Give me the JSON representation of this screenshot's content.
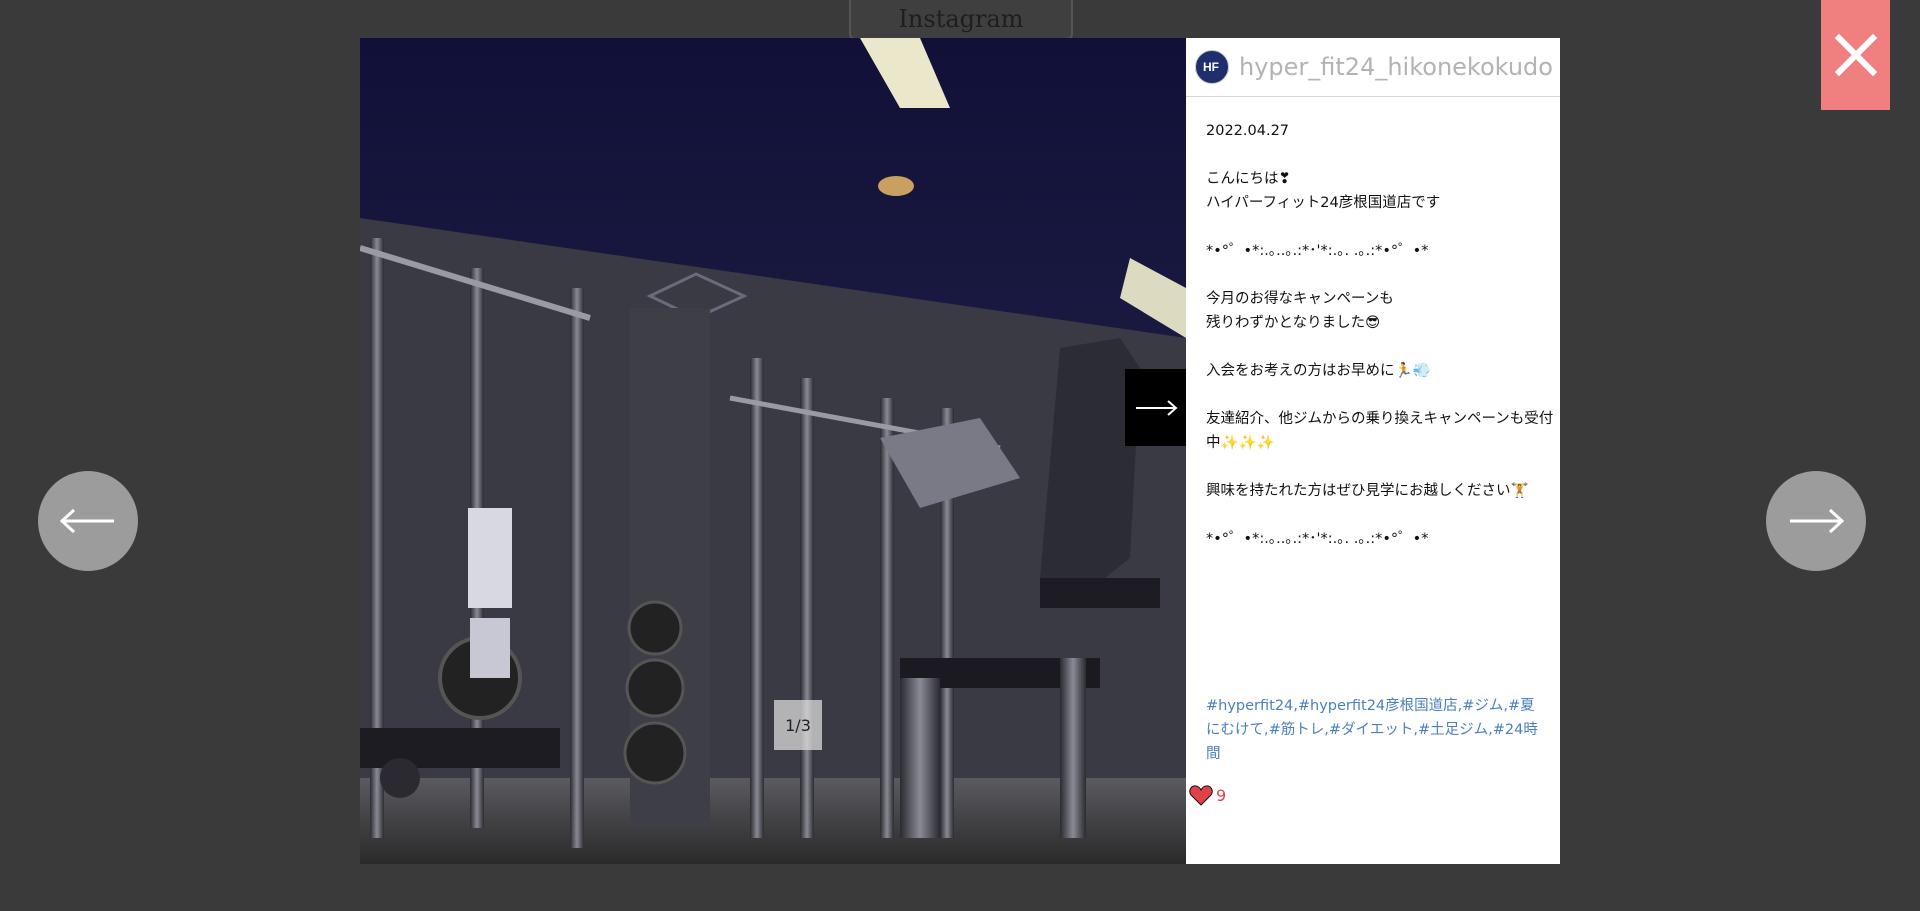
{
  "background_title": "Instagram",
  "slide_counter": "1/3",
  "post": {
    "username": "hyper_fit24_hikonekokudo",
    "lines": [
      "2022.04.27",
      "",
      "こんにちは❣",
      "ハイパーフィット24彦根国道店です",
      "",
      "*•°゜•*:.｡..｡.:*･'*:.｡. .｡.:*•°゜•*",
      "",
      "今月のお得なキャンペーンも",
      "残りわずかとなりました😎",
      "",
      "入会をお考えの方はお早めに🏃💨",
      "",
      "友達紹介、他ジムからの乗り換えキャンペーンも受付",
      "中✨✨✨",
      "",
      "興味を持たれた方はぜひ見学にお越しください🏋",
      "",
      "*•°゜•*:.｡..｡.:*･'*:.｡. .｡.:*•°゜•*"
    ],
    "hashtags": "#hyperfit24,#hyperfit24彦根国道店,#ジム,#夏にむけて,#筋トレ,#ダイエット,#土足ジム,#24時間",
    "likes": "9"
  },
  "icons": {
    "close": "close-icon",
    "prev": "arrow-left-icon",
    "next": "arrow-right-icon",
    "like": "heart-icon"
  },
  "colors": {
    "overlay": "#3a3a3a",
    "close_bg": "#f08080",
    "hashtag": "#4a7fbd",
    "likes": "#e0424a"
  }
}
